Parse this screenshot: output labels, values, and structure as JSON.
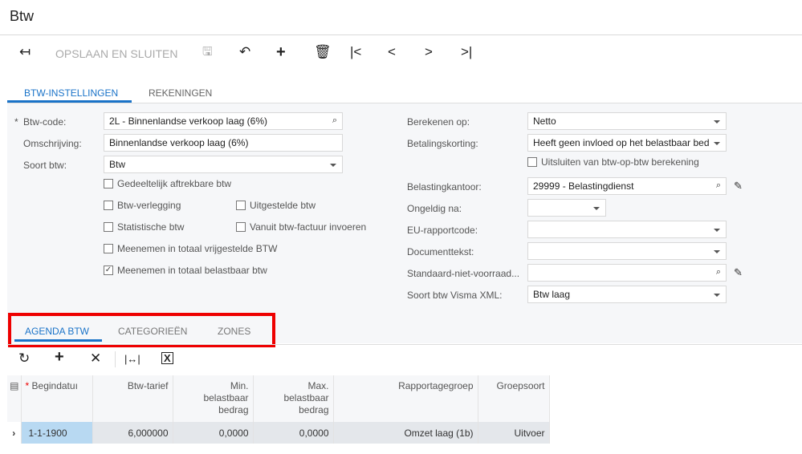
{
  "title": "Btw",
  "toolbar": {
    "save_close": "OPSLAAN EN SLUITEN"
  },
  "tabs": [
    {
      "label": "BTW-INSTELLINGEN",
      "active": true
    },
    {
      "label": "REKENINGEN"
    }
  ],
  "form_left": {
    "btw_code": {
      "label": "Btw-code:",
      "value": "2L - Binnenlandse verkoop laag (6%)",
      "required": "*"
    },
    "omschrijving": {
      "label": "Omschrijving:",
      "value": "Binnenlandse verkoop laag (6%)"
    },
    "soort_btw": {
      "label": "Soort btw:",
      "value": "Btw"
    },
    "checkboxes": [
      {
        "label": "Gedeeltelijk aftrekbare btw",
        "checked": false
      },
      {
        "label": "Btw-verlegging",
        "checked": false
      },
      {
        "label": "Uitgestelde btw",
        "checked": false
      },
      {
        "label": "Statistische btw",
        "checked": false
      },
      {
        "label": "Vanuit btw-factuur invoeren",
        "checked": false
      },
      {
        "label": "Meenemen in totaal vrijgestelde BTW",
        "checked": false
      },
      {
        "label": "Meenemen in totaal belastbaar btw",
        "checked": true
      }
    ]
  },
  "form_right": {
    "berekenen": {
      "label": "Berekenen op:",
      "value": "Netto"
    },
    "betalingskorting": {
      "label": "Betalingskorting:",
      "value": "Heeft geen invloed op het belastbaar bed"
    },
    "uitsluiten": {
      "label": "Uitsluiten van btw-op-btw berekening",
      "checked": false
    },
    "belastingkantoor": {
      "label": "Belastingkantoor:",
      "value": "29999 - Belastingdienst"
    },
    "ongeldig": {
      "label": "Ongeldig na:",
      "value": ""
    },
    "eu": {
      "label": "EU-rapportcode:",
      "value": ""
    },
    "documenttekst": {
      "label": "Documenttekst:",
      "value": ""
    },
    "standaard": {
      "label": "Standaard-niet-voorraad...",
      "value": ""
    },
    "visma": {
      "label": "Soort btw Visma XML:",
      "value": "Btw laag"
    }
  },
  "bottom_tabs": [
    {
      "label": "AGENDA BTW",
      "active": true
    },
    {
      "label": "CATEGORIEËN"
    },
    {
      "label": "ZONES"
    }
  ],
  "grid": {
    "columns": [
      "Begindatuı",
      "Btw-tarief",
      "Min.\nbelastbaar\nbedrag",
      "Max.\nbelastbaar\nbedrag",
      "Rapportagegroep",
      "Groepsoort"
    ],
    "rows": [
      [
        "1-1-1900",
        "6,000000",
        "0,0000",
        "0,0000",
        "Omzet laag (1b)",
        "Uitvoer"
      ]
    ]
  },
  "colors": {
    "accent": "#1a73c8",
    "highlight": "#e00000"
  }
}
